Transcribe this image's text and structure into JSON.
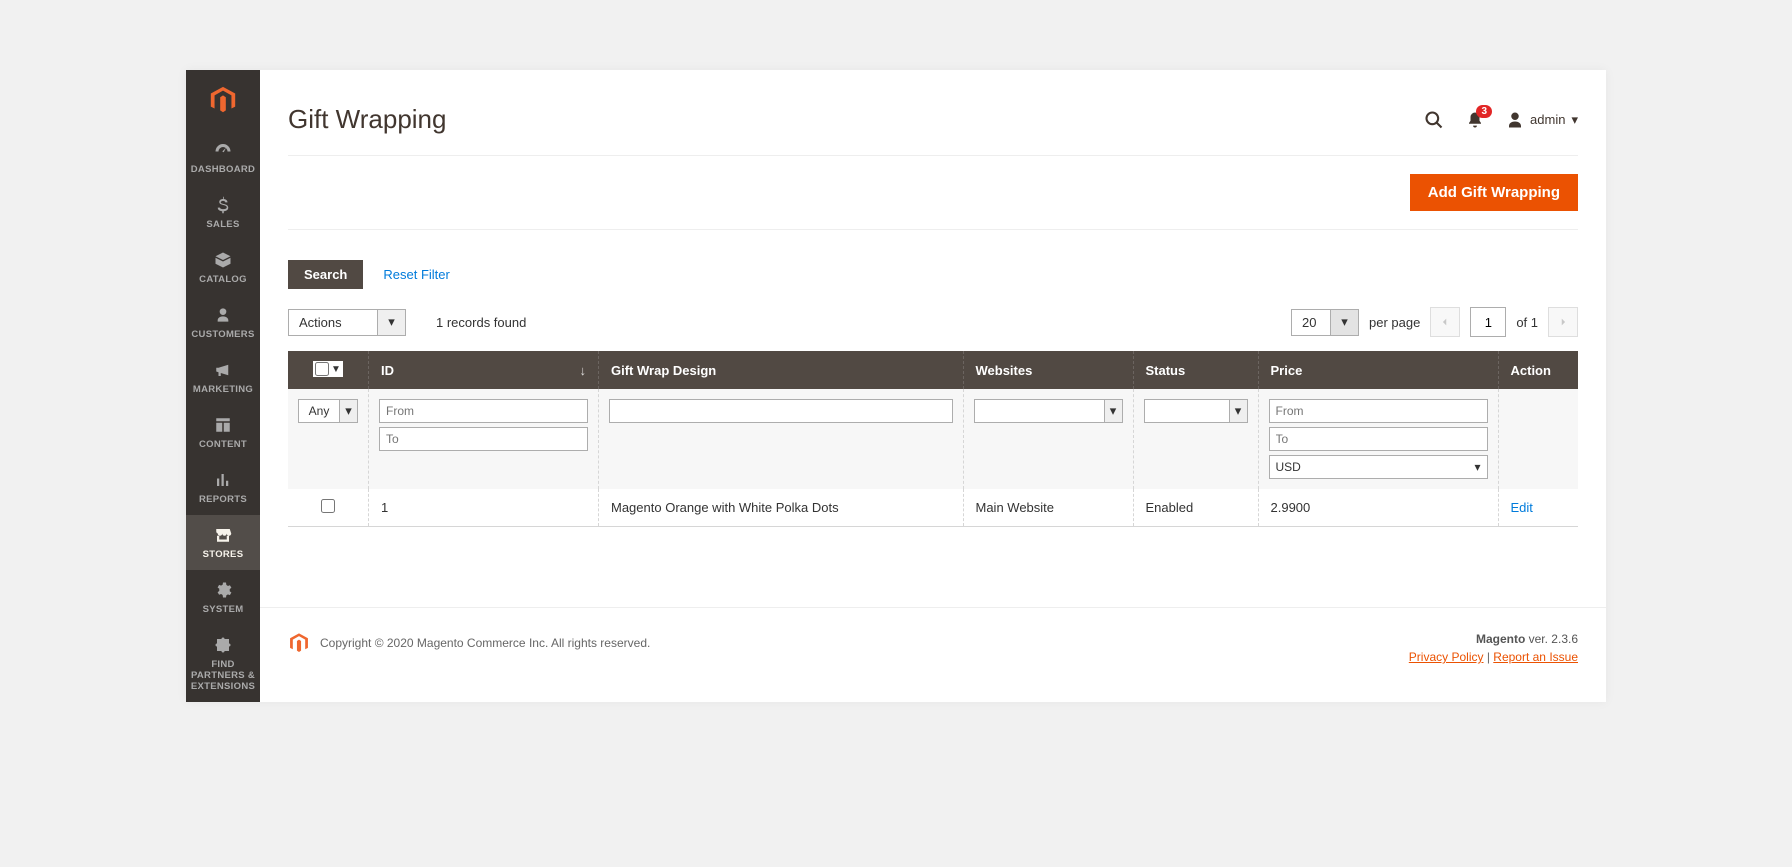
{
  "sidebar": {
    "items": [
      {
        "label": "DASHBOARD"
      },
      {
        "label": "SALES"
      },
      {
        "label": "CATALOG"
      },
      {
        "label": "CUSTOMERS"
      },
      {
        "label": "MARKETING"
      },
      {
        "label": "CONTENT"
      },
      {
        "label": "REPORTS"
      },
      {
        "label": "STORES"
      },
      {
        "label": "SYSTEM"
      },
      {
        "label": "FIND PARTNERS & EXTENSIONS"
      }
    ]
  },
  "header": {
    "title": "Gift Wrapping",
    "notif_count": "3",
    "user": "admin"
  },
  "actions": {
    "add_label": "Add Gift Wrapping",
    "search_label": "Search",
    "reset_label": "Reset Filter",
    "actions_label": "Actions"
  },
  "pager": {
    "records": "1 records found",
    "page_size": "20",
    "per_page": "per page",
    "current": "1",
    "of_text": "of 1"
  },
  "grid": {
    "columns": {
      "id": "ID",
      "design": "Gift Wrap Design",
      "websites": "Websites",
      "status": "Status",
      "price": "Price",
      "action": "Action"
    },
    "filters": {
      "any": "Any",
      "from": "From",
      "to": "To",
      "currency": "USD"
    },
    "rows": [
      {
        "id": "1",
        "design": "Magento Orange with White Polka Dots",
        "websites": "Main Website",
        "status": "Enabled",
        "price": "2.9900",
        "action": "Edit"
      }
    ]
  },
  "footer": {
    "copyright": "Copyright © 2020 Magento Commerce Inc. All rights reserved.",
    "product": "Magento",
    "version": " ver. 2.3.6",
    "privacy": "Privacy Policy",
    "report": "Report an Issue"
  }
}
